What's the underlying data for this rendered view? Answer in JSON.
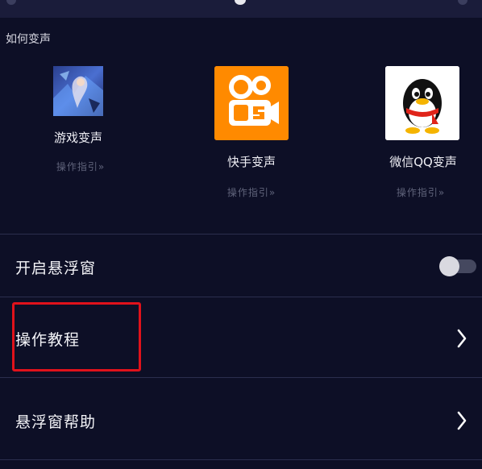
{
  "section": {
    "title": "如何变声"
  },
  "apps": [
    {
      "name": "游戏变声",
      "guide": "操作指引»",
      "icon": "game-hero-art"
    },
    {
      "name": "快手变声",
      "guide": "操作指引»",
      "icon": "kuaishou-logo"
    },
    {
      "name": "微信QQ变声",
      "guide": "操作指引»",
      "icon": "qq-penguin-logo"
    }
  ],
  "settings": [
    {
      "label": "开启悬浮窗",
      "control": "toggle",
      "state": "off"
    },
    {
      "label": "操作教程",
      "control": "chevron"
    },
    {
      "label": "悬浮窗帮助",
      "control": "chevron"
    }
  ],
  "colors": {
    "background": "#0d0f26",
    "highlight_border": "#e0121b",
    "kuaishou_orange": "#ff8a00"
  }
}
